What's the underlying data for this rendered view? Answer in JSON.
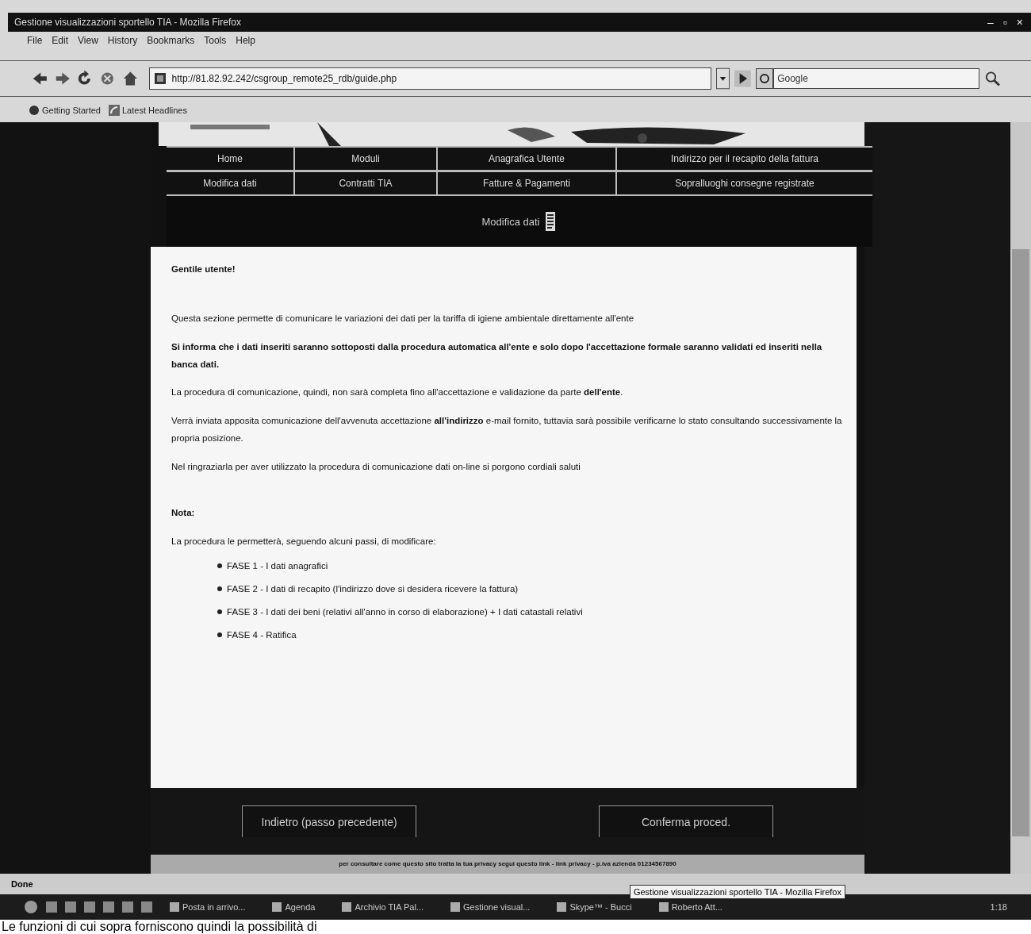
{
  "window": {
    "title": "Gestione visualizzazioni sportello TIA - Mozilla Firefox",
    "controls": [
      "–",
      "▫",
      "×"
    ]
  },
  "menu": [
    "File",
    "Edit",
    "View",
    "History",
    "Bookmarks",
    "Tools",
    "Help"
  ],
  "address_bar": {
    "value": "http://81.82.92.242/csgroup_remote25_rdb/guide.php"
  },
  "search_field": {
    "placeholder": "Google"
  },
  "bookmarks": [
    "Getting Started",
    "Latest Headlines"
  ],
  "nav": {
    "rows": [
      {
        "cells": [
          "Home",
          "Moduli",
          "Anagrafica Utente",
          "Indirizzo per il recapito della fattura"
        ]
      },
      {
        "cells": [
          "Modifica dati",
          "Contratti TIA",
          "Fatture & Pagamenti",
          "Sopralluoghi consegne registrate"
        ]
      }
    ]
  },
  "section_title": "Modifica dati",
  "greeting": "Gentile utente!",
  "paragraphs": [
    {
      "text": "Questa sezione permette di comunicare le variazioni dei dati per la tariffa di igiene ambientale direttamente all'ente"
    },
    {
      "text": "**Si informa che i dati inseriti saranno sottoposti dalla procedura automatica all'ente e solo dopo l'accettazione formale saranno validati ed inseriti nella banca dati.**"
    },
    {
      "text": "La procedura di comunicazione, quindi, non sarà completa fino all'accettazione e validazione da parte **dell'ente**."
    },
    {
      "text": "Verrà inviata apposita comunicazione dell'avvenuta accettazione **all'indirizzo** e-mail fornito, tuttavia sarà possibile verificarne lo stato consultando successivamente la propria posizione."
    },
    {
      "text": "Nel ringraziarla per aver utilizzato la procedura di comunicazione dati on-line si porgono cordiali saluti"
    }
  ],
  "note_label": "Nota:",
  "note_intro": "La procedura le permetterà, seguendo alcuni passi, di modificare:",
  "steps": [
    "FASE 1 - I dati anagrafici",
    "FASE 2 - I dati di recapito (l'indirizzo dove si desidera ricevere la fattura)",
    "FASE 3 - I dati dei beni (relativi all'anno in corso di elaborazione) + I dati catastali relativi",
    "FASE 4 - Ratifica"
  ],
  "buttons": [
    "Indietro (passo precedente)",
    "Conferma proced."
  ],
  "footer": "per consultare come questo sito tratta la tua privacy segui questo link - link privacy - p.iva azienda 01234567890",
  "status_bar": {
    "text": "Done"
  },
  "tooltip": "Gestione visualizzazioni sportello TIA - Mozilla Firefox",
  "taskbar": {
    "items": [
      "Posta in arrivo...",
      "Agenda",
      "Archivio TIA Pal...",
      "Gestione visual...",
      "Skype™ - Bucci",
      "Roberto Att..."
    ],
    "clock": "1:18"
  },
  "caption": "Le funzioni di cui sopra forniscono quindi la possibilità di"
}
